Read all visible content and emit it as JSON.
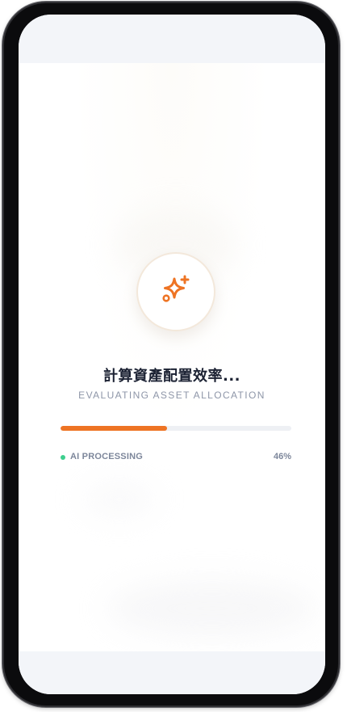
{
  "loading": {
    "title": "計算資產配置效率...",
    "subtitle": "EVALUATING ASSET ALLOCATION",
    "progress_fraction": 0.46,
    "status_label": "AI PROCESSING",
    "percent_label": "46%",
    "icon": "sparkles-icon"
  },
  "colors": {
    "accent": "#ee7424",
    "status_dot": "#3ecf8e",
    "track": "#eef0f4",
    "title_text": "#1c2233",
    "muted_text": "#8e96a8"
  }
}
